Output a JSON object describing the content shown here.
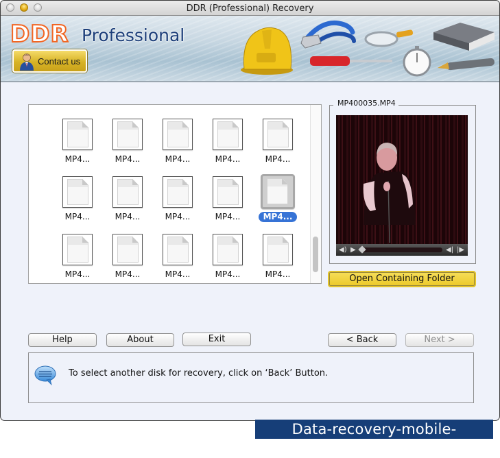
{
  "window": {
    "title": "DDR (Professional) Recovery",
    "traffic_lights": [
      "close",
      "minimize",
      "zoom"
    ]
  },
  "banner": {
    "logo_primary": "DDR",
    "logo_secondary": "Professional",
    "contact_button": "Contact us",
    "decorative_icons": [
      "hard-hat-icon",
      "pliers-icon",
      "magnifier-icon",
      "screwdriver-icon",
      "stopwatch-icon",
      "book-icon",
      "fountain-pen-icon"
    ]
  },
  "file_grid": {
    "items": [
      {
        "label": "MP4...",
        "selected": false
      },
      {
        "label": "MP4...",
        "selected": false
      },
      {
        "label": "MP4...",
        "selected": false
      },
      {
        "label": "MP4...",
        "selected": false
      },
      {
        "label": "MP4...",
        "selected": false
      },
      {
        "label": "MP4...",
        "selected": false
      },
      {
        "label": "MP4...",
        "selected": false
      },
      {
        "label": "MP4...",
        "selected": false
      },
      {
        "label": "MP4...",
        "selected": false
      },
      {
        "label": "MP4...",
        "selected": true
      },
      {
        "label": "MP4...",
        "selected": false
      },
      {
        "label": "MP4...",
        "selected": false
      },
      {
        "label": "MP4...",
        "selected": false
      },
      {
        "label": "MP4...",
        "selected": false
      },
      {
        "label": "MP4...",
        "selected": false
      }
    ],
    "scroll_position": "bottom"
  },
  "preview": {
    "title": "MP400035.MP4",
    "controls": {
      "volume": "◀)",
      "play": "▶",
      "prev": "◀|",
      "next": "|▶"
    },
    "progress_fraction": 0.0
  },
  "actions": {
    "open_folder": "Open Containing Folder",
    "help": "Help",
    "about": "About",
    "exit": "Exit",
    "back": "< Back",
    "next": "Next >",
    "next_enabled": false
  },
  "info": {
    "message": "To select another disk for recovery, click on ‘Back’ Button."
  },
  "watermark": "Data-recovery-mobile-phone.com",
  "colors": {
    "selection_blue": "#3673d6",
    "accent_yellow": "#ecc928",
    "logo_orange": "#f26522",
    "logo_navy": "#1d3f7a",
    "watermark_bg": "#163e78",
    "window_bg": "#eff2fa"
  }
}
